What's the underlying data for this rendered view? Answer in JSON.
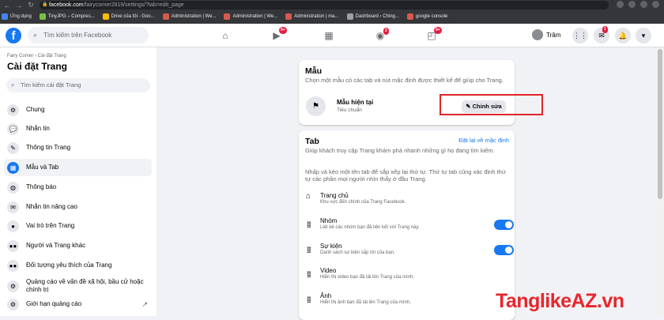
{
  "browser": {
    "url_host": "facebook.com",
    "url_path": "/fairycorner2819/settings/?tab=edit_page",
    "bookmarks": [
      {
        "label": "Ứng dụng",
        "color": "#4285f4"
      },
      {
        "label": "TinyJPG – Compres...",
        "color": "#7ac143"
      },
      {
        "label": "Drive của tôi - Goo...",
        "color": "#fbbc04"
      },
      {
        "label": "Administration | We...",
        "color": "#d55a4c"
      },
      {
        "label": "Administration | We...",
        "color": "#d55a4c"
      },
      {
        "label": "Administration | ma...",
        "color": "#d55a4c"
      },
      {
        "label": "Dashboard ‹ Ching...",
        "color": "#9aa0a6"
      },
      {
        "label": "google console",
        "color": "#d55a4c"
      }
    ]
  },
  "fb_header": {
    "search_placeholder": "Tìm kiếm trên Facebook",
    "badges": {
      "watch": "9+",
      "groups": "2",
      "gaming": "9+",
      "messenger": "1"
    },
    "user_name": "Trâm"
  },
  "sidebar": {
    "breadcrumb": "Fairy Corner › Cài đặt Trang",
    "title": "Cài đặt Trang",
    "search_placeholder": "Tìm kiếm cài đặt Trang",
    "items": [
      {
        "label": "Chung",
        "icon": "gear-icon"
      },
      {
        "label": "Nhắn tin",
        "icon": "chat-icon"
      },
      {
        "label": "Thông tin Trang",
        "icon": "pencil-icon"
      },
      {
        "label": "Mẫu và Tab",
        "icon": "grid-icon"
      },
      {
        "label": "Thông báo",
        "icon": "globe-icon"
      },
      {
        "label": "Nhắn tin nâng cao",
        "icon": "messenger-icon"
      },
      {
        "label": "Vai trò trên Trang",
        "icon": "person-icon"
      },
      {
        "label": "Người và Trang khác",
        "icon": "people-icon"
      },
      {
        "label": "Đối tượng yêu thích của Trang",
        "icon": "people-icon"
      },
      {
        "label": "Quảng cáo về vấn đề xã hội, bầu cử hoặc chính trị",
        "icon": "settings-icon"
      },
      {
        "label": "Giới hạn quảng cáo",
        "icon": "gear-icon"
      }
    ],
    "active_index": 3
  },
  "template_card": {
    "title": "Mẫu",
    "description": "Chọn một mẫu có các tab và nút mặc định được thiết kế để giúp cho Trang.",
    "current_label": "Mẫu hiện tại",
    "current_value": "Tiêu chuẩn",
    "edit_button": "Chỉnh sửa"
  },
  "tab_card": {
    "title": "Tab",
    "reset_link": "Đặt lại về mặc định",
    "description1": "Giúp khách truy cập Trang khám phá nhanh những gì họ đang tìm kiếm.",
    "description2": "Nhấp và kéo một tên tab để sắp xếp lại thứ tự. Thứ tự tab cũng xác định thứ tự các phần mọi người nhìn thấy ở đầu Trang.",
    "tabs": [
      {
        "name": "Trang chủ",
        "desc": "Khu vực đến chính của Trang Facebook.",
        "toggle": false
      },
      {
        "name": "Nhóm",
        "desc": "Liệt kê các nhóm bạn đã liên kết với Trang này.",
        "toggle": true
      },
      {
        "name": "Sự kiện",
        "desc": "Danh sách sự kiện sắp tới của bạn.",
        "toggle": true
      },
      {
        "name": "Video",
        "desc": "Hiển thị video bạn đã tải lên Trang của mình.",
        "toggle": false
      },
      {
        "name": "Ảnh",
        "desc": "Hiển thị ảnh bạn đã tải lên Trang của mình.",
        "toggle": false
      }
    ]
  },
  "watermark": "TanglikeAZ.vn"
}
